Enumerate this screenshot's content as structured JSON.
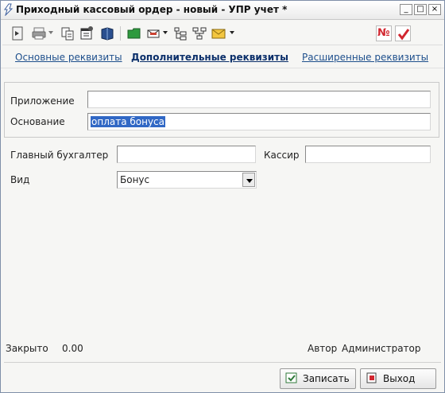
{
  "window": {
    "title": "Приходный кассовый ордер  - новый - УПР учет *",
    "min_label": "_",
    "max_label": "□",
    "close_label": "×"
  },
  "toolbar": {
    "icons": [
      "save-doc-icon",
      "print-icon",
      "copy-icon",
      "properties-icon",
      "book-icon",
      "folder-icon",
      "envelope-icon",
      "tree-icon",
      "structure-icon",
      "mail-icon",
      "number-icon",
      "check-icon"
    ],
    "number_label": "№"
  },
  "tabs": [
    {
      "label": "Основные реквизиты"
    },
    {
      "label": "Дополнительные реквизиты"
    },
    {
      "label": "Расширенные реквизиты"
    }
  ],
  "form": {
    "prilozhenie_label": "Приложение",
    "prilozhenie_value": "",
    "osnovanie_label": "Основание",
    "osnovanie_value": "оплата бонуса",
    "glavbuh_label": "Главный бухгалтер",
    "glavbuh_value": "",
    "kassir_label": "Кассир",
    "kassir_value": "",
    "vid_label": "Вид",
    "vid_value": "Бонус"
  },
  "footer": {
    "zakryto_label": "Закрыто",
    "zakryto_value": "0.00",
    "avtor_label": "Автор",
    "avtor_value": "Администратор"
  },
  "buttons": {
    "save_label": "Записать",
    "exit_label": "Выход"
  },
  "colors": {
    "selection": "#3168c5",
    "tab_link": "#1e4f8c",
    "tab_active": "#0b2f6a",
    "number_icon": "#d2262f"
  }
}
